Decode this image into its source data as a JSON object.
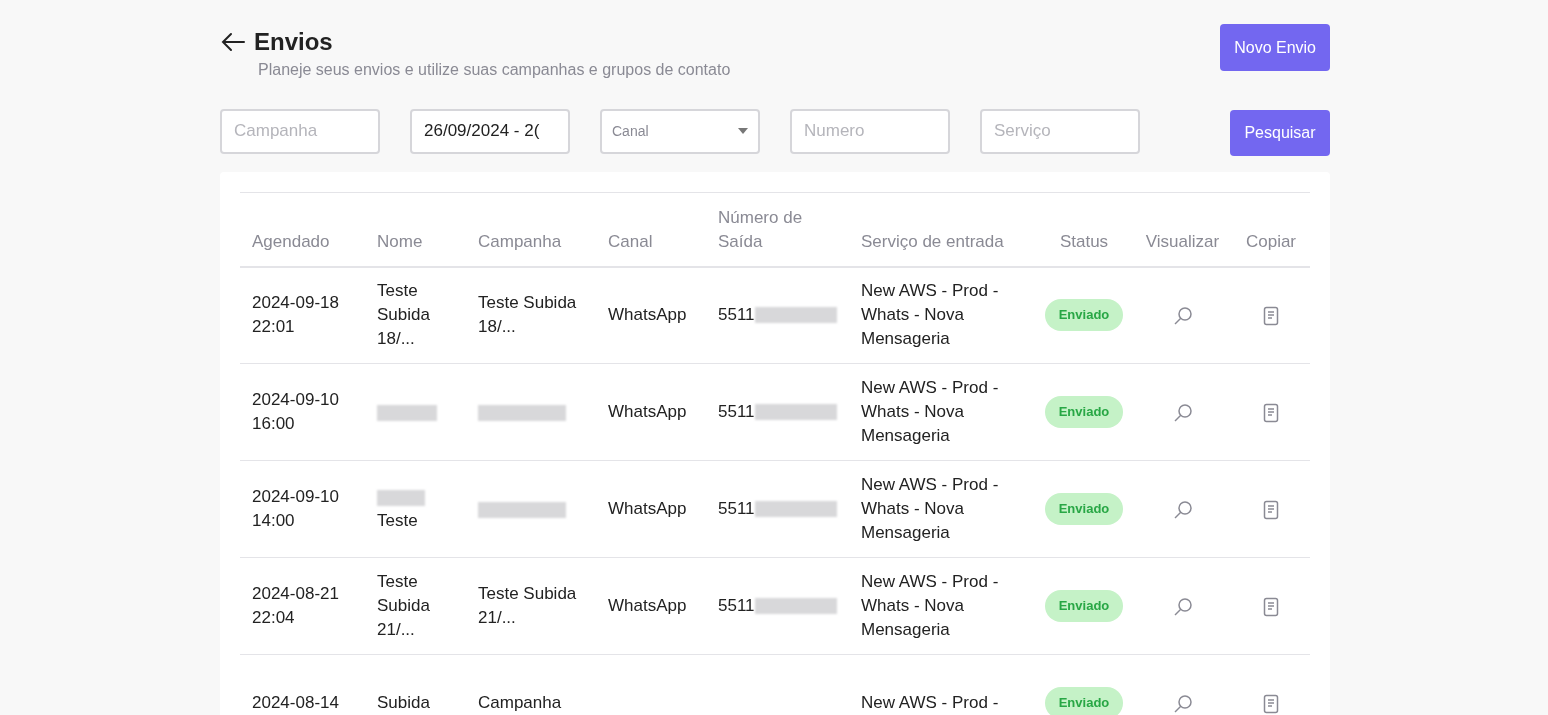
{
  "header": {
    "title": "Envios",
    "subtitle": "Planeje seus envios e utilize suas campanhas e grupos de contato",
    "new_button": "Novo Envio"
  },
  "filters": [
    {
      "kind": "text",
      "placeholder": "Campanha"
    },
    {
      "kind": "text",
      "value": "26/09/2024 - 2("
    },
    {
      "kind": "select",
      "placeholder": "Canal"
    },
    {
      "kind": "text",
      "placeholder": "Numero"
    },
    {
      "kind": "text",
      "placeholder": "Serviço"
    }
  ],
  "search_button": "Pesquisar",
  "table": {
    "columns": [
      "Agendado",
      "Nome",
      "Campanha",
      "Canal",
      "Número de Saída",
      "Serviço de entrada",
      "Status",
      "Visualizar",
      "Copiar"
    ],
    "rows": [
      {
        "scheduled": "2024-09-18 22:01",
        "name": "Teste Subida 18/...",
        "campaign": "Teste Subida 18/...",
        "channel": "WhatsApp",
        "number": "5511",
        "number_redacted": true,
        "service": "New AWS - Prod - Whats - Nova Mensageria",
        "status": "Enviado"
      },
      {
        "scheduled": "2024-09-10 16:00",
        "name_redacted": true,
        "campaign_redacted": true,
        "channel": "WhatsApp",
        "number": "5511",
        "number_redacted": true,
        "service": "New AWS - Prod - Whats - Nova Mensageria",
        "status": "Enviado"
      },
      {
        "scheduled": "2024-09-10 14:00",
        "name_redacted": true,
        "name": "Teste",
        "campaign_redacted": true,
        "channel": "WhatsApp",
        "number": "5511",
        "number_redacted": true,
        "service": "New AWS - Prod - Whats - Nova Mensageria",
        "status": "Enviado"
      },
      {
        "scheduled": "2024-08-21 22:04",
        "name": "Teste Subida 21/...",
        "campaign": "Teste Subida 21/...",
        "channel": "WhatsApp",
        "number": "5511",
        "number_redacted": true,
        "service": "New AWS - Prod - Whats - Nova Mensageria",
        "status": "Enviado"
      },
      {
        "scheduled": "2024-08-14",
        "name": "Subida",
        "campaign": "Campanha",
        "service": "New AWS - Prod -",
        "status": "Enviado"
      }
    ]
  }
}
